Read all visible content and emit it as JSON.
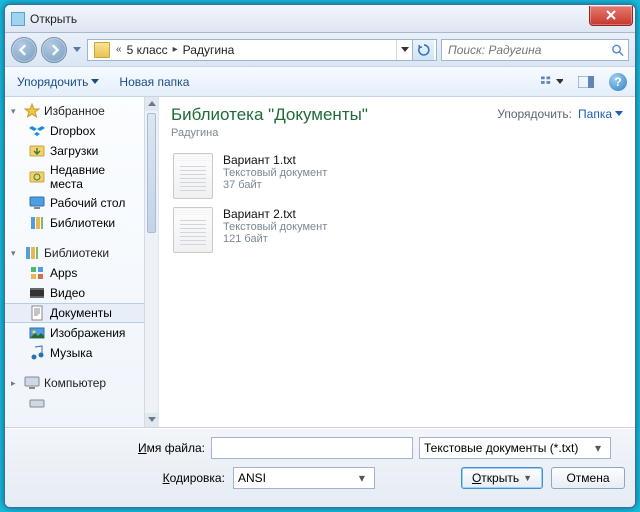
{
  "window": {
    "title": "Открыть"
  },
  "nav": {
    "crumb_root": "«",
    "crumb1": "5 класс",
    "crumb2": "Радугина"
  },
  "search": {
    "placeholder": "Поиск: Радугина"
  },
  "toolbar": {
    "organize": "Упорядочить",
    "newfolder": "Новая папка"
  },
  "sidebar": {
    "favorites": {
      "label": "Избранное",
      "items": [
        "Dropbox",
        "Загрузки",
        "Недавние места",
        "Рабочий стол",
        "Библиотеки"
      ]
    },
    "libraries": {
      "label": "Библиотеки",
      "items": [
        "Apps",
        "Видео",
        "Документы",
        "Изображения",
        "Музыка"
      ],
      "selected_index": 2
    },
    "computer": {
      "label": "Компьютер"
    }
  },
  "main": {
    "title": "Библиотека \"Документы\"",
    "subtitle": "Радугина",
    "sort_label": "Упорядочить:",
    "sort_value": "Папка"
  },
  "files": [
    {
      "name": "Вариант 1.txt",
      "type": "Текстовый документ",
      "size": "37 байт"
    },
    {
      "name": "Вариант 2.txt",
      "type": "Текстовый документ",
      "size": "121 байт"
    }
  ],
  "footer": {
    "file_label_pre": "И",
    "file_label_rest": "мя файла:",
    "encoding_label_pre": "К",
    "encoding_label_rest": "одировка:",
    "file_name": "",
    "encoding": "ANSI",
    "filter": "Текстовые документы (*.txt)",
    "open_pre": "О",
    "open_rest": "ткрыть",
    "cancel": "Отмена"
  }
}
